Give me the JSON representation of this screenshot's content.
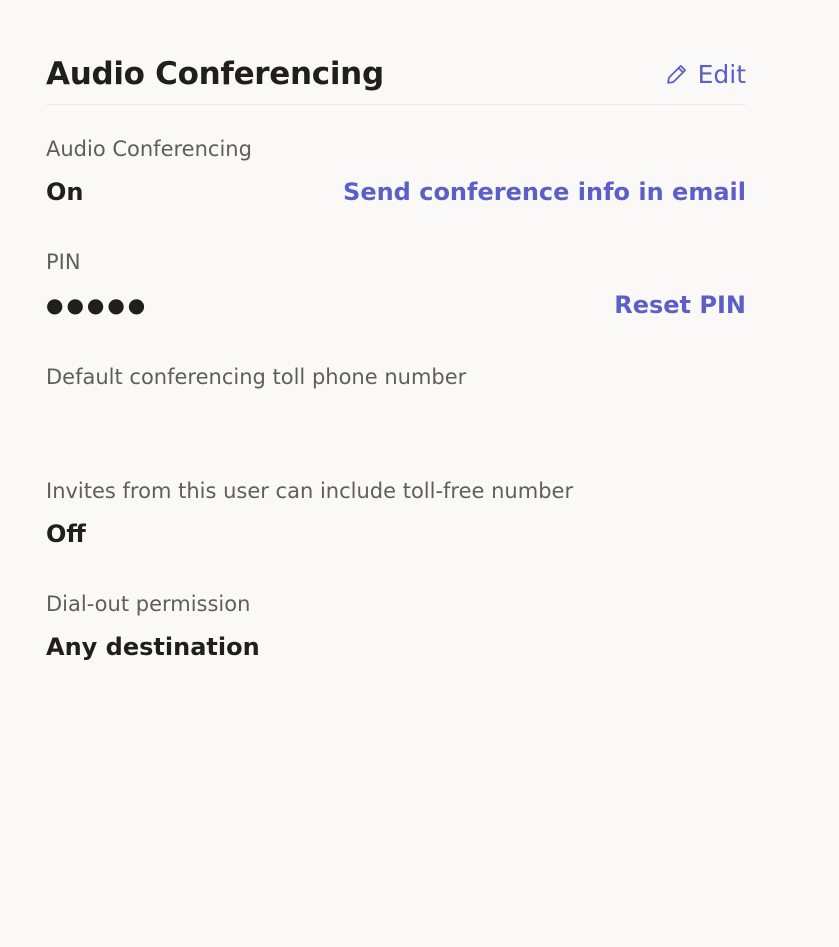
{
  "panel": {
    "title": "Audio Conferencing",
    "edit_label": "Edit"
  },
  "fields": {
    "audio_conferencing": {
      "label": "Audio Conferencing",
      "value": "On",
      "action": "Send conference info in email"
    },
    "pin": {
      "label": "PIN",
      "value": "●●●●●",
      "action": "Reset PIN"
    },
    "toll_number": {
      "label": "Default conferencing toll phone number",
      "value": ""
    },
    "toll_free": {
      "label": "Invites from this user can include toll-free number",
      "value": "Off"
    },
    "dial_out": {
      "label": "Dial-out permission",
      "value": "Any destination"
    }
  },
  "colors": {
    "accent": "#5b5fc7",
    "background": "#faf9f8",
    "text_primary": "#201f1e",
    "text_secondary": "#605e5c"
  },
  "icons": {
    "edit": "pencil-icon"
  }
}
